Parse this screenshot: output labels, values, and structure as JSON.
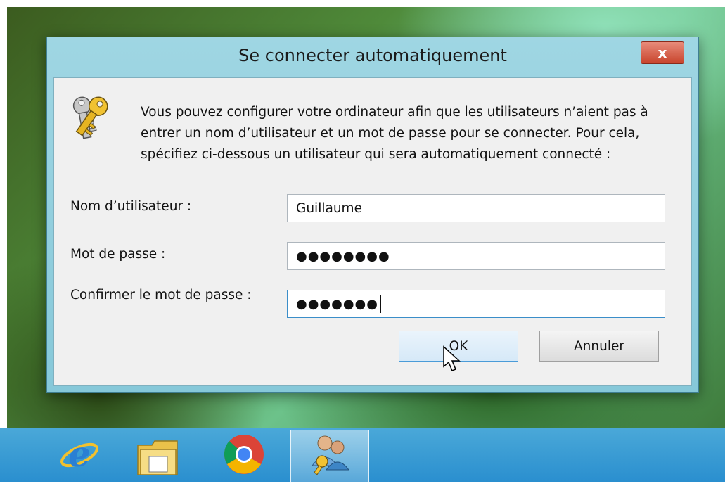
{
  "dialog": {
    "title": "Se connecter automatiquement",
    "close_label": "x",
    "intro_text": "Vous pouvez configurer votre ordinateur afin que les utilisateurs n’aient pas à entrer un nom d’utilisateur et un mot de passe pour se connecter. Pour cela, spécifiez ci-dessous un utilisateur qui sera automatiquement connecté :",
    "username_label": "Nom d’utilisateur :",
    "username_value": "Guillaume",
    "password_label": "Mot de passe :",
    "password_value": "●●●●●●●●",
    "confirm_label": "Confirmer le mot de passe :",
    "confirm_value": "●●●●●●●",
    "ok_label": "OK",
    "cancel_label": "Annuler",
    "icon": "keys-icon"
  },
  "taskbar": {
    "items": [
      {
        "icon": "internet-explorer-icon"
      },
      {
        "icon": "file-explorer-icon"
      },
      {
        "icon": "chrome-icon"
      },
      {
        "icon": "user-accounts-icon",
        "active": true
      }
    ]
  },
  "colors": {
    "dialog_frame": "#9fd6e3",
    "close_button": "#c8442c",
    "taskbar": "#2a8fcf",
    "ok_border": "#4a9bd8"
  }
}
